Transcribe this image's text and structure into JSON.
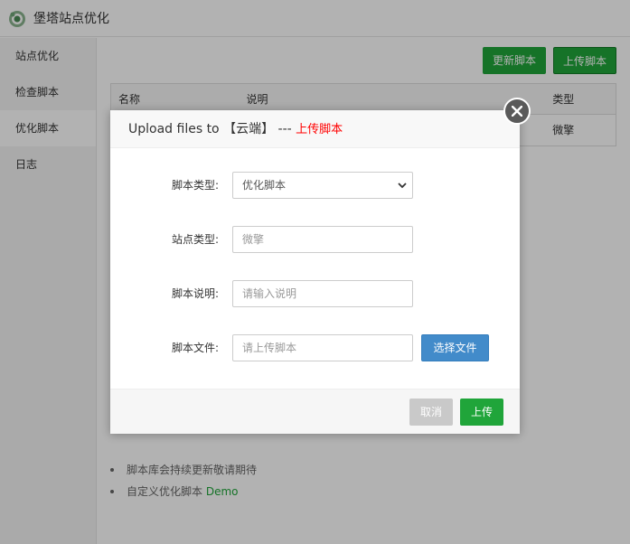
{
  "app": {
    "title": "堡塔站点优化",
    "logo_icon": "bt-logo-icon"
  },
  "sidebar": {
    "items": [
      {
        "label": "站点优化",
        "active": false
      },
      {
        "label": "检查脚本",
        "active": false
      },
      {
        "label": "优化脚本",
        "active": true
      },
      {
        "label": "日志",
        "active": false
      }
    ]
  },
  "toolbar": {
    "update_label": "更新脚本",
    "upload_label": "上传脚本"
  },
  "table": {
    "headers": [
      "名称",
      "说明",
      "类型"
    ],
    "rows": [
      {
        "name": "",
        "desc": "",
        "type": "微擎"
      }
    ]
  },
  "notes": {
    "item1": "脚本库会持续更新敬请期待",
    "item2_prefix": "自定义优化脚本",
    "item2_link": "Demo"
  },
  "dialog": {
    "title_prefix": "Upload files to 【云端】 --- ",
    "title_highlight": "上传脚本",
    "close_icon": "close-icon",
    "fields": {
      "script_type_label": "脚本类型:",
      "script_type_value": "优化脚本",
      "site_type_label": "站点类型:",
      "site_type_placeholder": "微擎",
      "desc_label": "脚本说明:",
      "desc_placeholder": "请输入说明",
      "file_label": "脚本文件:",
      "file_placeholder": "请上传脚本",
      "choose_file_label": "选择文件"
    },
    "cancel_label": "取消",
    "submit_label": "上传"
  },
  "colors": {
    "brand_green": "#20a53a",
    "choose_blue": "#428bca",
    "highlight_red": "#ff0000"
  }
}
